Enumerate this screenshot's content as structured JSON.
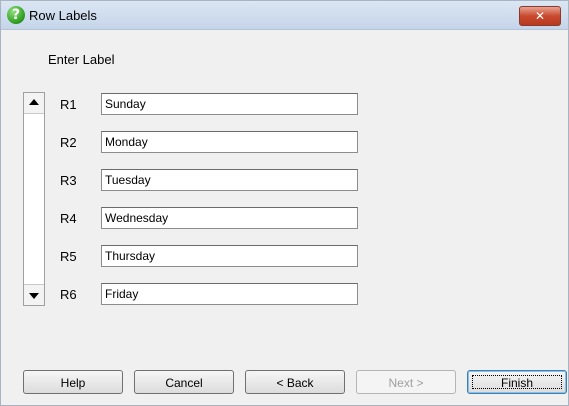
{
  "window": {
    "title": "Row Labels",
    "close_glyph": "✕",
    "icon_glyph": "?"
  },
  "prompt": "Enter Label",
  "rows": [
    {
      "label": "R1",
      "value": "Sunday"
    },
    {
      "label": "R2",
      "value": "Monday"
    },
    {
      "label": "R3",
      "value": "Tuesday"
    },
    {
      "label": "R4",
      "value": "Wednesday"
    },
    {
      "label": "R5",
      "value": "Thursday"
    },
    {
      "label": "R6",
      "value": "Friday"
    }
  ],
  "buttons": {
    "help": "Help",
    "cancel": "Cancel",
    "back": "< Back",
    "next": "Next >",
    "finish": "Finish"
  },
  "colors": {
    "title_bar": "#c5d5e9",
    "close_button": "#c94a2e",
    "window_bg": "#f0f0f0"
  }
}
